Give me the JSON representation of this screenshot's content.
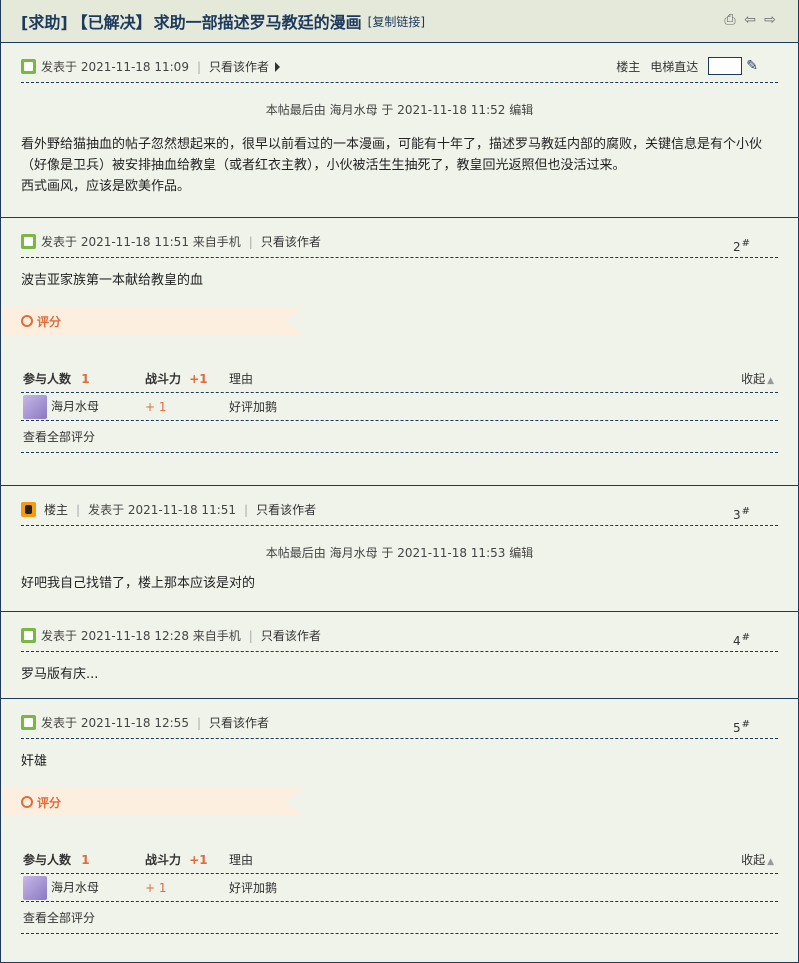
{
  "title": {
    "tag1": "[求助]",
    "tag2": "【已解决】",
    "text": "求助一部描述罗马教廷的漫画",
    "copy": "[复制链接]"
  },
  "common": {
    "only_author": "只看该作者",
    "owner": "楼主",
    "elevator": "电梯直达",
    "rating": "评分",
    "participants": "参与人数",
    "power": "战斗力",
    "reason": "理由",
    "collapse": "收起",
    "view_all": "查看全部评分"
  },
  "posts": [
    {
      "posted": "发表于 2021-11-18 11:09",
      "edit": "本帖最后由 海月水母 于 2021-11-18 11:52 编辑",
      "content": "看外野给猫抽血的帖子忽然想起来的，很早以前看过的一本漫画，可能有十年了，描述罗马教廷内部的腐败，关键信息是有个小伙（好像是卫兵）被安排抽血给教皇（或者红衣主教），小伙被活生生抽死了，教皇回光返照但也没活过来。",
      "content2": "西式画风，应该是欧美作品。"
    },
    {
      "posted": "发表于 2021-11-18 11:51 来自手机",
      "floor": "2",
      "content": "波吉亚家族第一本献给教皇的血",
      "rating": {
        "count": "1",
        "power_total": "+1",
        "user": "海月水母",
        "power": "+ 1",
        "reason": "好评加鹅"
      }
    },
    {
      "posted": "发表于 2021-11-18 11:51",
      "floor": "3",
      "edit": "本帖最后由 海月水母 于 2021-11-18 11:53 编辑",
      "content": "好吧我自己找错了，楼上那本应该是对的"
    },
    {
      "posted": "发表于 2021-11-18 12:28 来自手机",
      "floor": "4",
      "content": "罗马版有庆..."
    },
    {
      "posted": "发表于 2021-11-18 12:55",
      "floor": "5",
      "content": "奸雄",
      "rating": {
        "count": "1",
        "power_total": "+1",
        "user": "海月水母",
        "power": "+ 1",
        "reason": "好评加鹅"
      }
    }
  ],
  "floor_mark": "#"
}
